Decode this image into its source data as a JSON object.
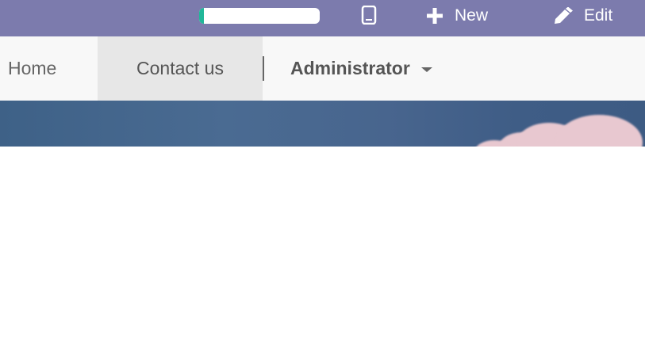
{
  "topbar": {
    "progress": 0.04,
    "progress_color": "#21b799",
    "background_color": "#7c7bad",
    "device_icon": "mobile-preview-icon",
    "new_label": "New",
    "new_icon": "plus-icon",
    "edit_label": "Edit",
    "edit_icon": "pencil-icon"
  },
  "navbar": {
    "items": [
      {
        "label": "Home",
        "active": false
      },
      {
        "label": "Contact us",
        "active": true
      }
    ],
    "user_menu": {
      "label": "Administrator",
      "icon": "caret-down-icon"
    }
  },
  "banner": {
    "colors": [
      "#3e6187",
      "#e8c8d0"
    ]
  }
}
